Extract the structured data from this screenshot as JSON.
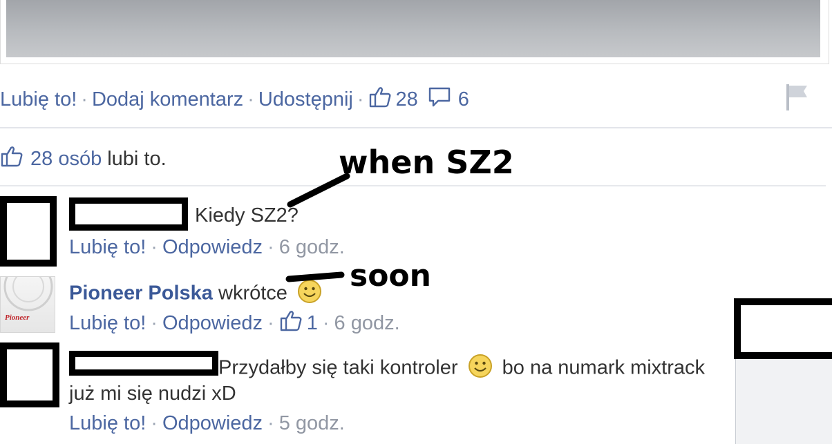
{
  "post_actions": {
    "like": "Lubię to!",
    "comment": "Dodaj komentarz",
    "share": "Udostępnij",
    "like_count": "28",
    "comment_count": "6"
  },
  "likes_summary": {
    "people_link": "28 osób",
    "suffix": "lubi to."
  },
  "comments": [
    {
      "author": "",
      "text": "Kiedy SZ2?",
      "like_label": "Lubię to!",
      "reply_label": "Odpowiedz",
      "time": "6 godz."
    },
    {
      "author": "Pioneer Polska",
      "text": "wkrótce",
      "like_label": "Lubię to!",
      "reply_label": "Odpowiedz",
      "likes": "1",
      "time": "6 godz.",
      "avatar_logo": "Pioneer"
    },
    {
      "author": "",
      "text_line1": "Przydałby się taki kontroler",
      "text_line1b": "bo na numark mixtrack",
      "text_line2": "już mi się nudzi xD",
      "like_label": "Lubię to!",
      "reply_label": "Odpowiedz",
      "time": "5 godz."
    }
  ],
  "annotations": {
    "when": "when SZ2",
    "soon": "soon"
  },
  "icons": {
    "thumbs_up": "thumbs-up-icon",
    "comment_bubble": "comment-bubble-icon",
    "flag": "flag-icon",
    "smiley": "smiley-icon"
  },
  "colors": {
    "link": "#4c67a1",
    "author": "#3b5998",
    "text": "#333333",
    "muted": "#9197a3"
  }
}
